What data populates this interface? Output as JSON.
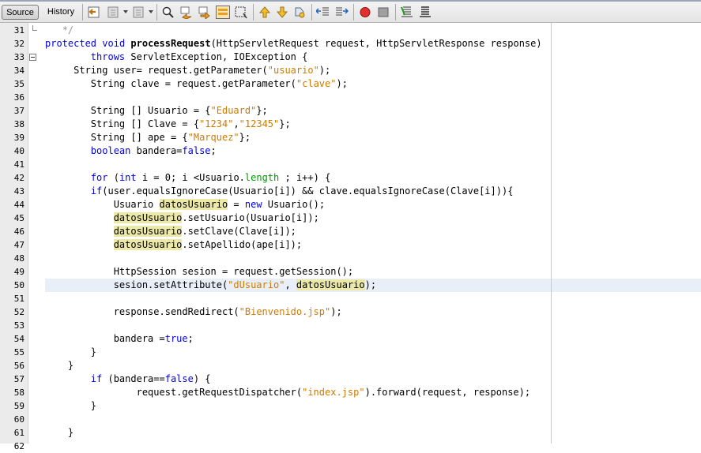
{
  "toolbar": {
    "source_label": "Source",
    "history_label": "History",
    "icons": [
      "back-history-icon",
      "prev-edit-icon",
      "next-edit-icon",
      "find-selection-icon",
      "find-previous-icon",
      "find-next-icon",
      "toggle-highlight-icon",
      "toggle-rect-selection-icon",
      "prev-bookmark-icon",
      "next-bookmark-icon",
      "toggle-bookmark-icon",
      "shift-left-icon",
      "shift-right-icon",
      "start-macro-icon",
      "stop-macro-icon",
      "comment-icon",
      "uncomment-icon"
    ]
  },
  "editor": {
    "lines": [
      {
        "num": "31",
        "html": "   <span class=\"cmt\">*/</span>"
      },
      {
        "num": "32",
        "html": "<span class=\"kw\">protected</span> <span class=\"kw\">void</span> <span class=\"bold\">processRequest</span>(HttpServletRequest request, HttpServletResponse response)"
      },
      {
        "num": "33",
        "html": "        <span class=\"kw\">throws</span> ServletException, IOException {"
      },
      {
        "num": "34",
        "html": "     String user= request.getParameter(<span class=\"str\">\"usuario\"</span>);"
      },
      {
        "num": "35",
        "html": "        String clave = request.getParameter(<span class=\"str\">\"clave\"</span>);"
      },
      {
        "num": "36",
        "html": ""
      },
      {
        "num": "37",
        "html": "        String [] Usuario = {<span class=\"str\">\"Eduard\"</span>};"
      },
      {
        "num": "38",
        "html": "        String [] Clave = {<span class=\"str\">\"1234\"</span>,<span class=\"str\">\"12345\"</span>};"
      },
      {
        "num": "39",
        "html": "        String [] ape = {<span class=\"str\">\"Marquez\"</span>};"
      },
      {
        "num": "40",
        "html": "        <span class=\"kw\">boolean</span> bandera=<span class=\"kw\">false</span>;"
      },
      {
        "num": "41",
        "html": ""
      },
      {
        "num": "42",
        "html": "        <span class=\"kw\">for</span> (<span class=\"kw\">int</span> i = 0; i &lt;Usuario.<span class=\"fld\">length</span> ; i++) {"
      },
      {
        "num": "43",
        "html": "        <span class=\"kw\">if</span>(user.equalsIgnoreCase(Usuario[i]) &amp;&amp; clave.equalsIgnoreCase(Clave[i])){"
      },
      {
        "num": "44",
        "html": "            Usuario <span class=\"hl\">datosUsuario</span> = <span class=\"kw\">new</span> Usuario();"
      },
      {
        "num": "45",
        "html": "            <span class=\"hl\">datosUsuario</span>.setUsuario(Usuario[i]);"
      },
      {
        "num": "46",
        "html": "            <span class=\"hl\">datosUsuario</span>.setClave(Clave[i]);"
      },
      {
        "num": "47",
        "html": "            <span class=\"hl\">datosUsuario</span>.setApellido(ape[i]);"
      },
      {
        "num": "48",
        "html": ""
      },
      {
        "num": "49",
        "html": "            HttpSession sesion = request.getSession();"
      },
      {
        "num": "50",
        "html": "            sesion.setAttribute(<span class=\"str\">\"dUsuario\"</span>, <span class=\"hl\">datosUsuario</span>);"
      },
      {
        "num": "51",
        "html": ""
      },
      {
        "num": "52",
        "html": "            response.sendRedirect(<span class=\"str\">\"Bienvenido.jsp\"</span>);"
      },
      {
        "num": "53",
        "html": ""
      },
      {
        "num": "54",
        "html": "            bandera =<span class=\"kw\">true</span>;"
      },
      {
        "num": "55",
        "html": "        }"
      },
      {
        "num": "56",
        "html": "    }"
      },
      {
        "num": "57",
        "html": "        <span class=\"kw\">if</span> (bandera==<span class=\"kw\">false</span>) {"
      },
      {
        "num": "58",
        "html": "                request.getRequestDispatcher(<span class=\"str\">\"index.jsp\"</span>).forward(request, response);"
      },
      {
        "num": "59",
        "html": "        }"
      },
      {
        "num": "60",
        "html": ""
      },
      {
        "num": "61",
        "html": "    }"
      },
      {
        "num": "62",
        "html": ""
      }
    ]
  }
}
